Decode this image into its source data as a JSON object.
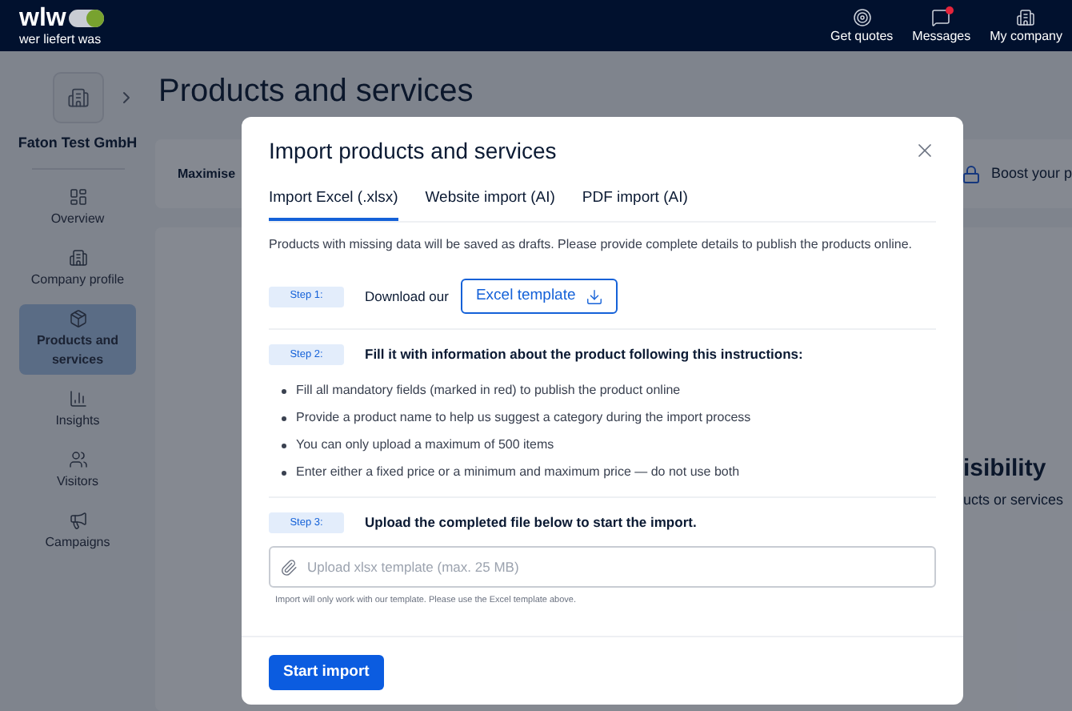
{
  "header": {
    "logo": {
      "mark": "wlw",
      "tagline": "wer liefert was"
    },
    "nav": [
      {
        "label": "Get quotes",
        "badge": false
      },
      {
        "label": "Messages",
        "badge": true
      },
      {
        "label": "My company",
        "badge": false
      }
    ]
  },
  "sidebar": {
    "company": "Faton Test GmbH",
    "items": [
      {
        "label": "Overview",
        "selected": false
      },
      {
        "label": "Company profile",
        "selected": false
      },
      {
        "label": "Products and services",
        "selected": true
      },
      {
        "label": "Insights",
        "selected": false
      },
      {
        "label": "Visitors",
        "selected": false
      },
      {
        "label": "Campaigns",
        "selected": false
      }
    ]
  },
  "page": {
    "title": "Products and services",
    "banner": {
      "text": "Maximise",
      "boost": "Boost your p"
    },
    "empty_state": {
      "heading": "isibility",
      "text": "ucts or services"
    }
  },
  "modal": {
    "title": "Import products and services",
    "tabs": [
      {
        "label": "Import Excel (.xlsx)",
        "selected": true
      },
      {
        "label": "Website import (AI)",
        "selected": false
      },
      {
        "label": "PDF import (AI)",
        "selected": false
      }
    ],
    "intro": "Products with missing data will be saved as drafts. Please provide complete details to publish the products online.",
    "steps": [
      {
        "kind": "download",
        "label": "Step 1:",
        "text": "Download our",
        "button": "Excel template"
      },
      {
        "kind": "instructions",
        "label": "Step 2:",
        "text": "Fill it with information about the product following this instructions:",
        "bullets": [
          "Fill all mandatory fields (marked in red) to publish the product online",
          "Provide a product name to help us suggest a category during the import process",
          "You can only upload a maximum of 500 items",
          "Enter either a fixed price or a minimum and maximum price — do not use both"
        ]
      },
      {
        "kind": "upload",
        "label": "Step 3:",
        "text": "Upload the completed file below to start the import.",
        "placeholder": "Upload xlsx template (max. 25 MB)",
        "hint": "Import will only work with our template. Please use the Excel template above."
      }
    ],
    "submit": "Start import"
  }
}
